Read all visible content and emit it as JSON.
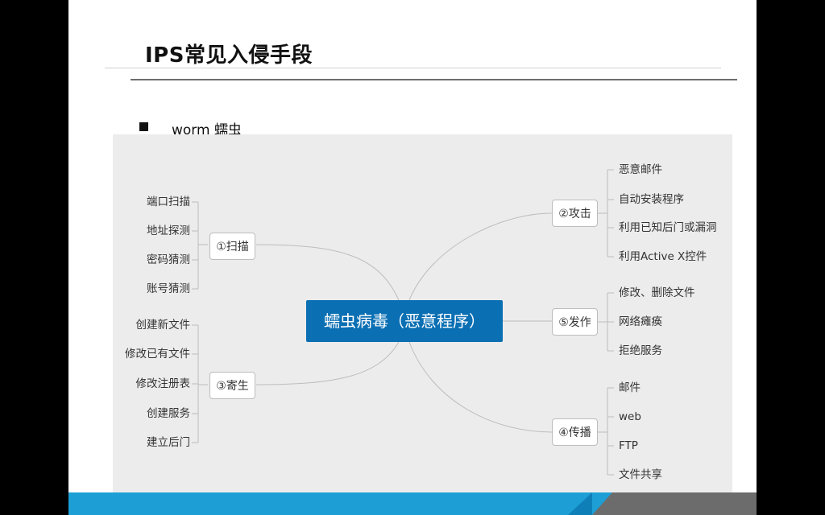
{
  "slide": {
    "title": "IPS常见入侵手段",
    "bullet": "worm 蠕虫"
  },
  "mindmap": {
    "center": "蠕虫病毒（恶意程序）",
    "branches": {
      "scan": {
        "label": "①扫描",
        "leaves": [
          "端口扫描",
          "地址探测",
          "密码猜测",
          "账号猜测"
        ]
      },
      "parasite": {
        "label": "③寄生",
        "leaves": [
          "创建新文件",
          "修改已有文件",
          "修改注册表",
          "创建服务",
          "建立后门"
        ]
      },
      "attack": {
        "label": "②攻击",
        "leaves": [
          "恶意邮件",
          "自动安装程序",
          "利用已知后门或漏洞",
          "利用Active X控件"
        ]
      },
      "trigger": {
        "label": "⑤发作",
        "leaves": [
          "修改、删除文件",
          "网络瘫痪",
          "拒绝服务"
        ]
      },
      "spread": {
        "label": "④传播",
        "leaves": [
          "邮件",
          "web",
          "FTP",
          "文件共享"
        ]
      }
    }
  },
  "colors": {
    "center_fill": "#0a6fb3",
    "panel_bg": "#ececec",
    "footer_blue": "#1d9fd6",
    "footer_gray": "#6c6c6c"
  }
}
